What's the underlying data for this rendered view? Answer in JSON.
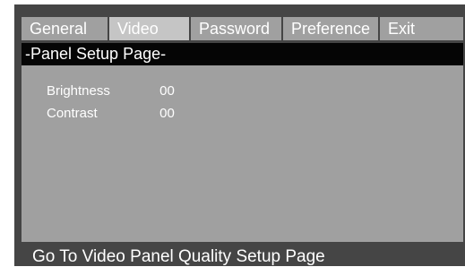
{
  "tabs": [
    {
      "label": "General",
      "selected": false
    },
    {
      "label": "Video",
      "selected": true
    },
    {
      "label": "Password",
      "selected": false
    },
    {
      "label": "Preference",
      "selected": false
    },
    {
      "label": "Exit",
      "selected": false
    }
  ],
  "page_title": "-Panel Setup Page-",
  "settings": [
    {
      "label": "Brightness",
      "value": "00"
    },
    {
      "label": "Contrast",
      "value": "00"
    }
  ],
  "status_text": "Go To Video Panel Quality Setup Page",
  "colors": {
    "frame": "#454545",
    "tab": "#a0a0a0",
    "tab_selected": "#c5c5c5",
    "header": "#050505",
    "panel": "#a0a0a0",
    "text": "#ffffff"
  }
}
